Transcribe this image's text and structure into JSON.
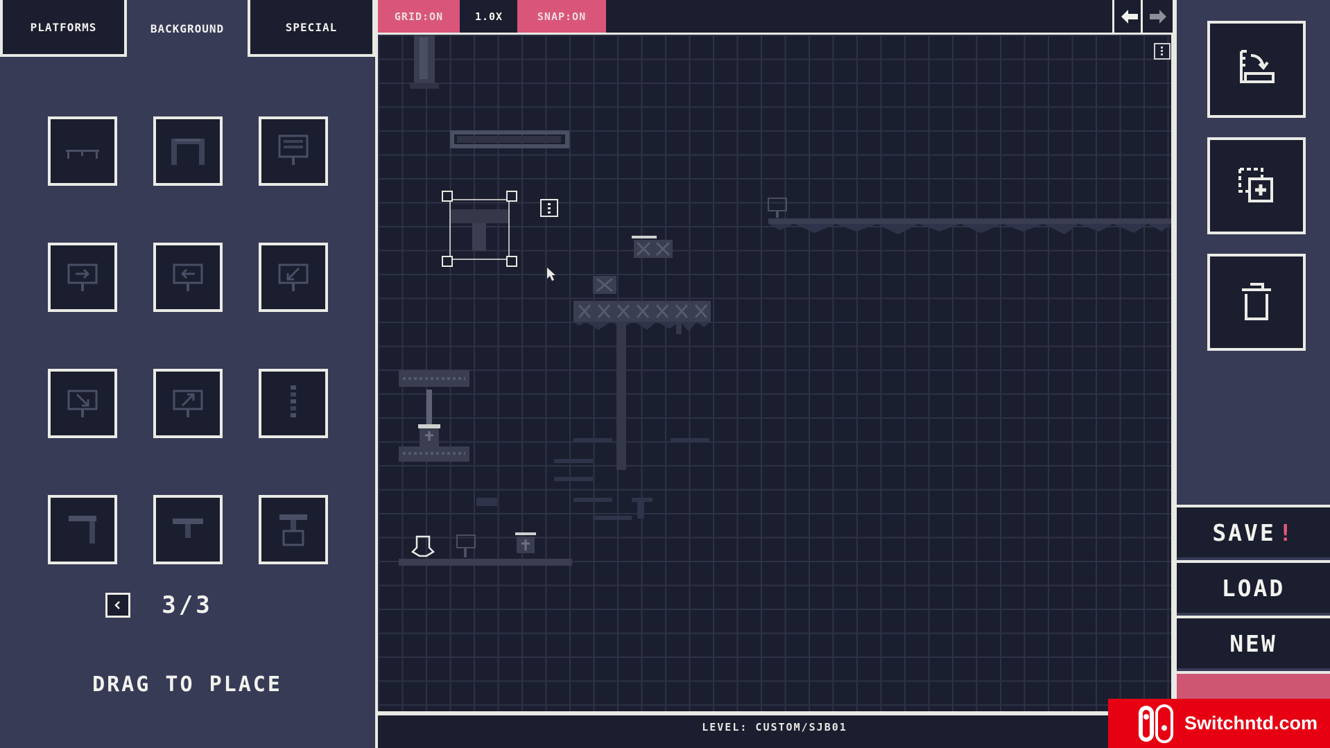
{
  "tabs": [
    {
      "id": "platforms",
      "label": "PLATFORMS"
    },
    {
      "id": "background",
      "label": "BACKGROUND"
    },
    {
      "id": "special",
      "label": "SPECIAL"
    }
  ],
  "active_tab": "background",
  "palette": {
    "items": [
      {
        "icon": "bench-icon"
      },
      {
        "icon": "archway-icon"
      },
      {
        "icon": "billboard-icon"
      },
      {
        "icon": "sign-arrow-right-icon"
      },
      {
        "icon": "sign-arrow-left-icon"
      },
      {
        "icon": "sign-arrow-down-left-icon"
      },
      {
        "icon": "sign-arrow-down-right-icon"
      },
      {
        "icon": "sign-arrow-up-right-icon"
      },
      {
        "icon": "chain-icon"
      },
      {
        "icon": "vine-corner-icon"
      },
      {
        "icon": "vine-tee-icon"
      },
      {
        "icon": "hanging-cage-icon"
      }
    ],
    "page": "3/3",
    "hint": "DRAG TO PLACE"
  },
  "toolbar": {
    "grid": "GRID:ON",
    "zoom": "1.0X",
    "snap": "SNAP:ON"
  },
  "status": {
    "level": "LEVEL: CUSTOM/SJB01"
  },
  "actions": {
    "save": "SAVE",
    "save_marker": "!",
    "load": "LOAD",
    "new": "NEW"
  },
  "watermark": {
    "text": "Switchntd.com"
  },
  "colors": {
    "accent": "#d9557a",
    "panel": "#373b56",
    "canvas": "#1b1e2e",
    "frame": "#e9e9e4"
  }
}
